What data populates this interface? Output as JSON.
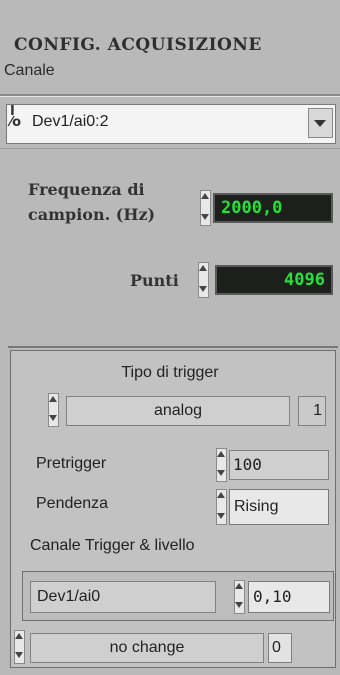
{
  "header": {
    "title": "CONFIG. ACQUISIZIONE",
    "channel_label": "Canale"
  },
  "channel": {
    "io_glyph": "I/O",
    "value": "Dev1/ai0:2"
  },
  "sampling": {
    "freq_label_line1": "Frequenza di",
    "freq_label_line2": "campion. (Hz)",
    "freq_value": "2000,0",
    "points_label": "Punti",
    "points_value": "4096"
  },
  "trigger": {
    "title": "Tipo di trigger",
    "type_value": "analog",
    "type_index": "1",
    "pretrigger_label": "Pretrigger",
    "pretrigger_value": "100",
    "slope_label": "Pendenza",
    "slope_value": "Rising",
    "channel_level_label": "Canale Trigger & livello",
    "trigger_channel": "Dev1/ai0",
    "level_value": "0,10",
    "change_value": "no change",
    "change_index": "0"
  },
  "colors": {
    "background": "#b9b9b9",
    "numeric_bg": "#1c1f1c",
    "numeric_text": "#27e13a"
  },
  "icons": [
    "io-glyph-icon",
    "dropdown-arrow-icon",
    "spinner-up-icon",
    "spinner-down-icon"
  ]
}
